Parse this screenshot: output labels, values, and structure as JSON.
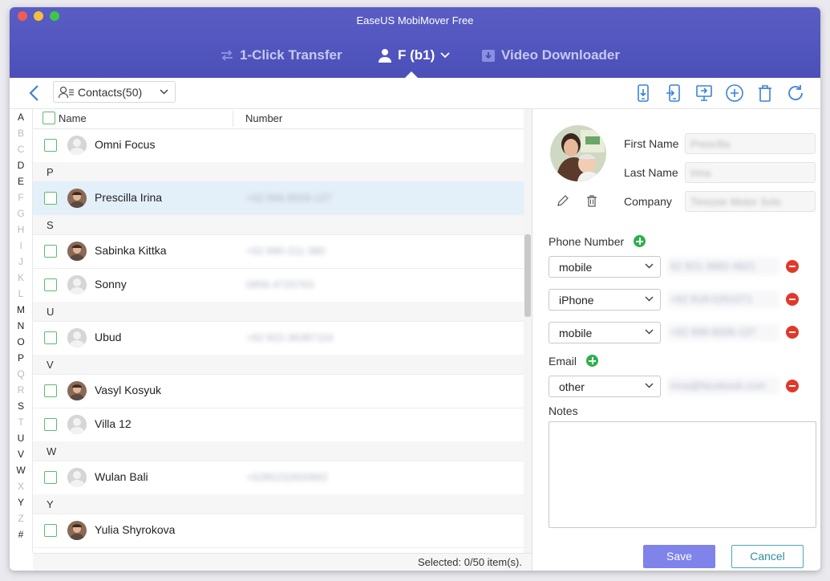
{
  "app": {
    "title": "EaseUS MobiMover Free"
  },
  "nav": {
    "transfer_label": "1-Click Transfer",
    "device_label": "F (b1)",
    "downloader_label": "Video Downloader"
  },
  "toolbar": {
    "category_label": "Contacts(50)"
  },
  "alphabet": [
    "A",
    "B",
    "C",
    "D",
    "E",
    "F",
    "G",
    "H",
    "I",
    "J",
    "K",
    "L",
    "M",
    "N",
    "O",
    "P",
    "Q",
    "R",
    "S",
    "T",
    "U",
    "V",
    "W",
    "X",
    "Y",
    "Z",
    "#"
  ],
  "alphabet_active": [
    "A",
    "D",
    "E",
    "M",
    "N",
    "O",
    "P",
    "S",
    "U",
    "V",
    "W",
    "Y",
    "#"
  ],
  "list": {
    "col_name": "Name",
    "col_number": "Number",
    "rows": [
      {
        "kind": "contact",
        "name": "Omni Focus",
        "number": "",
        "avatar": "default"
      },
      {
        "kind": "section",
        "letter": "P"
      },
      {
        "kind": "contact",
        "name": "Prescilla Irina",
        "number": "+62 896-8006-137",
        "avatar": "photo",
        "selected": true
      },
      {
        "kind": "section",
        "letter": "S"
      },
      {
        "kind": "contact",
        "name": "Sabinka Kittka",
        "number": "+62 890-211-380",
        "avatar": "photo"
      },
      {
        "kind": "contact",
        "name": "Sonny",
        "number": "0856-4720763",
        "avatar": "default"
      },
      {
        "kind": "section",
        "letter": "U"
      },
      {
        "kind": "contact",
        "name": "Ubud",
        "number": "+62 822-36387116",
        "avatar": "default"
      },
      {
        "kind": "section",
        "letter": "V"
      },
      {
        "kind": "contact",
        "name": "Vasyl Kosyuk",
        "number": "",
        "avatar": "photo"
      },
      {
        "kind": "contact",
        "name": "Villa 12",
        "number": "",
        "avatar": "default"
      },
      {
        "kind": "section",
        "letter": "W"
      },
      {
        "kind": "contact",
        "name": "Wulan Bali",
        "number": "+6285232600892",
        "avatar": "default"
      },
      {
        "kind": "section",
        "letter": "Y"
      },
      {
        "kind": "contact",
        "name": "Yulia Shyrokova",
        "number": "",
        "avatar": "photo"
      }
    ]
  },
  "status": {
    "selected_text": "Selected: 0/50 item(s)."
  },
  "detail": {
    "first_name_label": "First Name",
    "first_name_value": "Prescilla",
    "last_name_label": "Last Name",
    "last_name_value": "Irina",
    "company_label": "Company",
    "company_value": "Timozer Motor Solo",
    "phone_label": "Phone Number",
    "phones": [
      {
        "type": "mobile",
        "value": "62 821-3682-4621"
      },
      {
        "type": "iPhone",
        "value": "+62 818-0261071"
      },
      {
        "type": "mobile",
        "value": "+62 896-8006-137"
      }
    ],
    "email_label": "Email",
    "emails": [
      {
        "type": "other",
        "value": "irina@facebook.com"
      }
    ],
    "notes_label": "Notes",
    "save_label": "Save",
    "cancel_label": "Cancel"
  },
  "colors": {
    "accent": "#5a5dc4",
    "save": "#7f83ea",
    "green": "#2cb04b",
    "red": "#e3372b",
    "selected_row": "#e3eff9"
  }
}
